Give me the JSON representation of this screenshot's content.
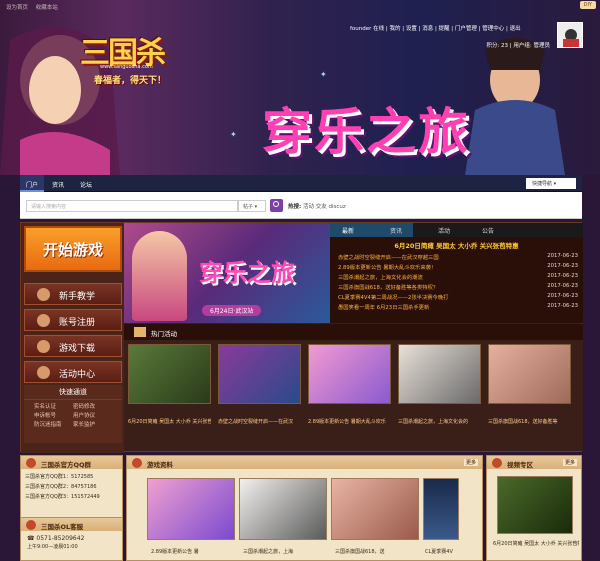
{
  "top": {
    "links": [
      "设为首页",
      "收藏本站"
    ],
    "diy": "DIY"
  },
  "logo": {
    "name": "三国杀",
    "url": "www.sanguosha.com",
    "slogan": "春福者，得天下！"
  },
  "hero": {
    "title": "穿乐之旅"
  },
  "user": {
    "row1": "founder 在线 | 我的 | 设置 | 消息 | 提醒 | 门户管理 | 管理中心 | 退出",
    "row2": "积分: 23 | 用户组: 管理员"
  },
  "nav": {
    "items": [
      "门户",
      "资讯",
      "论坛"
    ],
    "quick": "快捷导航"
  },
  "search": {
    "placeholder": "请输入搜索内容",
    "scope": "帖子",
    "hot_label": "热搜:",
    "hot_terms": [
      "活动",
      "交友",
      "discuz"
    ]
  },
  "left": {
    "start": "开始游戏",
    "buttons": [
      "新手教学",
      "账号注册",
      "游戏下载",
      "活动中心"
    ],
    "quick_title": "快速通道",
    "quick_links": [
      "实名认证",
      "密码修改",
      "申诉帐号",
      "用户协议",
      "防沉迷指南",
      "家长监护"
    ]
  },
  "banner": {
    "title": "穿乐之旅",
    "subtitle": "6月24日·武汉站"
  },
  "news": {
    "tabs": [
      "最新",
      "资讯",
      "活动",
      "公告"
    ],
    "headline": "6月20日简瘫 吴国太 大小乔 关兴张苞特惠",
    "items": [
      {
        "title": "赤壁之战时空裂缝开启——在武汉穿越三国",
        "date": "2017-06-23"
      },
      {
        "title": "2.89版本更新公告 暑期大乱斗欢乐来袭！",
        "date": "2017-06-23"
      },
      {
        "title": "三国杀潮起之旅，上海文化会的潮流",
        "date": "2017-06-23"
      },
      {
        "title": "三国杀旗国战618，送好备胜等各类特权？",
        "date": "2017-06-23"
      },
      {
        "title": "CL夏季赛4V4第二周战况——2张半决赛今晚打",
        "date": "2017-06-23"
      },
      {
        "title": "愚国笑看一周年 6月23日三国杀手更新",
        "date": "2017-06-23"
      }
    ]
  },
  "activities": {
    "title": "热门活动",
    "items": [
      "6月20日简瘫 吴国太 大小乔 关兴张苞",
      "赤壁之战时空裂缝开启——在武汉",
      "2.89版本更新公告 暑期大乱斗欢乐",
      "三国杀潮起之旅，上海文化会的",
      "三国杀旗国战618，送好备胜等"
    ]
  },
  "qq": {
    "title": "三国杀官方QQ群",
    "rows": [
      "三国杀官方QQ群1：5172585",
      "三国杀官方QQ群2：84757186",
      "三国杀官方QQ群3：151572449"
    ]
  },
  "service": {
    "title": "三国杀OL客服",
    "phone": "0571-85209642",
    "hours": "上午9:00—凌晨01:00"
  },
  "gameinfo": {
    "title": "游戏资料",
    "more": "更多",
    "caps": [
      "2.89版本更新公告 暑",
      "三国杀潮起之旅，上海",
      "三国杀旗国战618，送",
      "CL夏季赛4V"
    ]
  },
  "video": {
    "title": "视频专区",
    "more": "更多",
    "cap": "6月20日简瘫 吴国太 大小乔 关兴张苞特"
  }
}
